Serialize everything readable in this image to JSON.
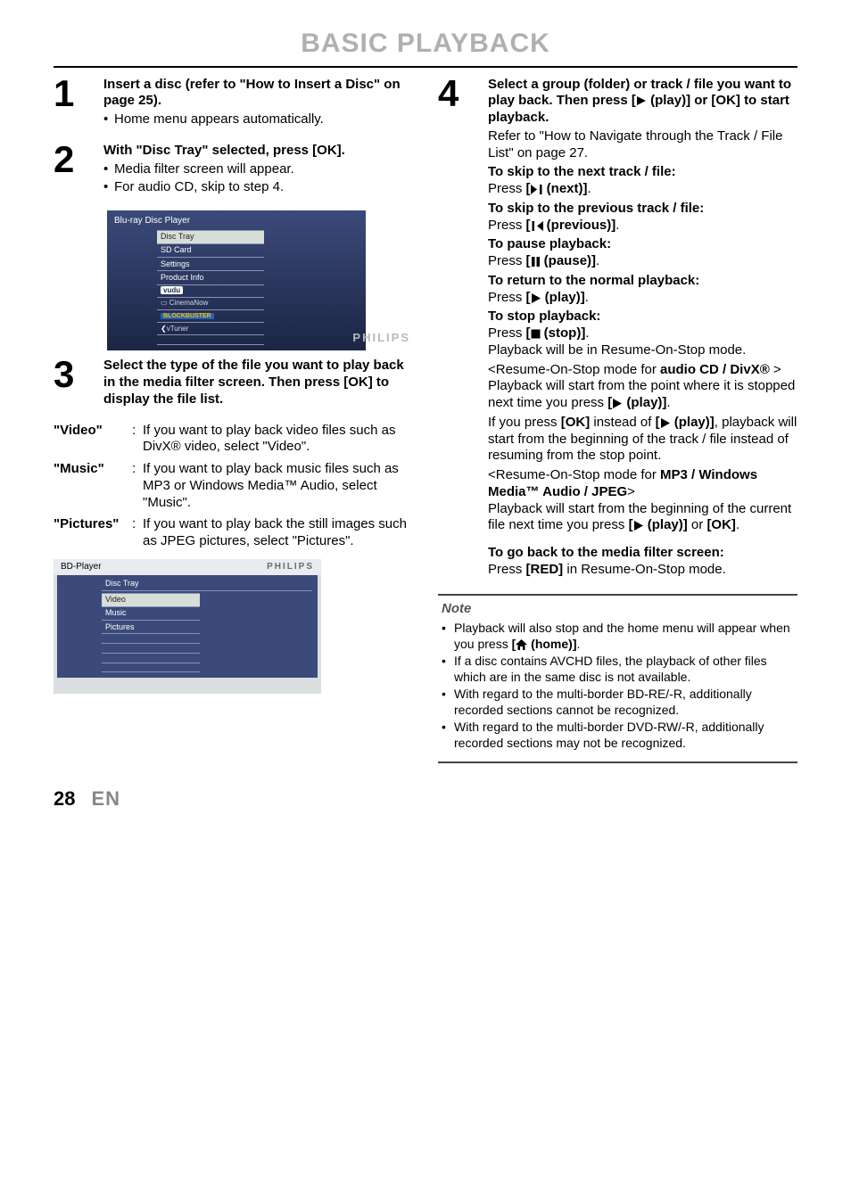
{
  "page": {
    "title": "BASIC PLAYBACK",
    "number": "28",
    "lang": "EN"
  },
  "step1": {
    "num": "1",
    "head": "Insert a disc (refer to \"How to Insert a Disc\" on page 25).",
    "b1": "Home menu appears automatically."
  },
  "step2": {
    "num": "2",
    "head": "With \"Disc Tray\" selected, press [OK].",
    "b1": "Media filter screen will appear.",
    "b2": "For audio CD, skip to step 4.",
    "osd": {
      "title": "Blu-ray Disc Player",
      "item1": "Disc Tray",
      "item2": "SD Card",
      "item3": "Settings",
      "item4": "Product Info",
      "brand": "PHILIPS"
    }
  },
  "step3": {
    "num": "3",
    "head": "Select the type of the file you want to play back in the media filter screen. Then press [OK] to display the file list.",
    "filters": {
      "k1": "\"Video\"",
      "v1": "If you want to play back video files such as DivX® video, select \"Video\".",
      "k2": "\"Music\"",
      "v2": "If you want to play back music files such as MP3 or Windows Media™ Audio, select \"Music\".",
      "k3": "\"Pictures\"",
      "v3": "If you want to play back the still images such as JPEG pictures, select \"Pictures\"."
    },
    "osd": {
      "head": "BD-Player",
      "brand": "PHILIPS",
      "cat": "Disc Tray",
      "item1": "Video",
      "item2": "Music",
      "item3": "Pictures"
    }
  },
  "step4": {
    "num": "4",
    "head_a": "Select a group (folder) or track / file you want to play back. Then press ",
    "head_b": " [",
    "head_c": " (play)] or [OK] to start playback.",
    "ref": "Refer to \"How to Navigate through the Track / File List\" on page 27.",
    "skipNextLbl": "To skip to the next track / file:",
    "skipNextTxt_a": "Press ",
    "skipNextTxt_b": "[",
    "skipNextTxt_c": " (next)]",
    "skipNextTxt_d": ".",
    "skipPrevLbl": "To skip to the previous track / file:",
    "skipPrevTxt_a": "Press ",
    "skipPrevTxt_b": "[",
    "skipPrevTxt_c": " (previous)]",
    "skipPrevTxt_d": ".",
    "pauseLbl": "To pause playback:",
    "pauseTxt_a": "Press ",
    "pauseTxt_b": "[",
    "pauseTxt_c": " (pause)]",
    "pauseTxt_d": ".",
    "returnLbl": "To return to the normal playback:",
    "returnTxt_a": "Press ",
    "returnTxt_b": "[",
    "returnTxt_c": " (play)]",
    "returnTxt_d": ".",
    "stopLbl": "To stop playback:",
    "stopTxt_a": "Press ",
    "stopTxt_b": "[",
    "stopTxt_c": " (stop)]",
    "stopTxt_d": ".",
    "resumeInfo": "Playback will be in Resume-On-Stop mode.",
    "resumeCd_a": "<Resume-On-Stop mode for ",
    "resumeCd_b": "audio CD / DivX®",
    "resumeCd_c": " >",
    "resumeCdTxt_a": "Playback will start from the point where it is stopped next time you press ",
    "resumeCdTxt_b": "[",
    "resumeCdTxt_c": " (play)]",
    "resumeCdTxt_d": ".",
    "okInstead_a": "If you press ",
    "okInstead_b": "[OK]",
    "okInstead_c": " instead of ",
    "okInstead_d": "[",
    "okInstead_e": " (play)]",
    "okInstead_f": ", playback will start from the beginning of the track / file instead of resuming from the stop point.",
    "resumeMp3_a": "<Resume-On-Stop mode for ",
    "resumeMp3_b": "MP3 / Windows Media™ Audio / JPEG",
    "resumeMp3_c": ">",
    "resumeMp3Txt_a": "Playback will start from the beginning of the current file next time you press ",
    "resumeMp3Txt_b": "[",
    "resumeMp3Txt_c": " (play)]",
    "resumeMp3Txt_d": " or ",
    "resumeMp3Txt_e": "[OK]",
    "resumeMp3Txt_f": ".",
    "backLbl": "To go back to the media filter screen:",
    "backTxt_a": "Press ",
    "backTxt_b": "[RED]",
    "backTxt_c": " in Resume-On-Stop mode."
  },
  "note": {
    "title": "Note",
    "i1_a": "Playback will also stop and the home menu will appear when you press ",
    "i1_b": "[",
    "i1_c": " (home)]",
    "i1_d": ".",
    "i2": "If a disc contains AVCHD files, the playback of other files which are in the same disc is not available.",
    "i3": "With regard to the multi-border BD-RE/-R, additionally recorded sections cannot be recognized.",
    "i4": "With regard to the multi-border DVD-RW/-R, additionally recorded sections may not be recognized."
  }
}
